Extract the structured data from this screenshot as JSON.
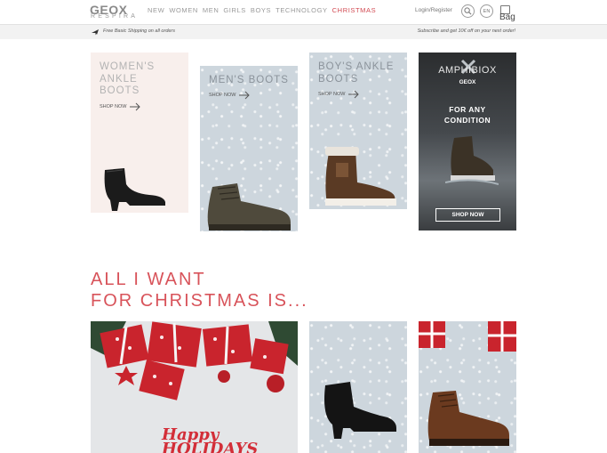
{
  "header": {
    "logo_main": "GEOX",
    "logo_sub": "RESPIRA",
    "nav": [
      "NEW",
      "WOMEN",
      "MEN",
      "GIRLS",
      "BOYS",
      "TECHNOLOGY",
      "CHRISTMAS"
    ],
    "login_label": "Login/Register",
    "lang_label": "EN",
    "bag_label": "Bag",
    "accent_color": "#d24a52"
  },
  "infobar": {
    "shipping_text": "Free Basic Shipping on all orders",
    "promo_text": "Subscribe and get 10€ off on your next order!"
  },
  "categories": [
    {
      "title_line1": "WOMEN'S",
      "title_line2": "ANKLE",
      "title_line3": "BOOTS",
      "cta": "SHOP NOW"
    },
    {
      "title_line1": "MEN'S BOOTS",
      "cta": "SHOP NOW"
    },
    {
      "title_line1": "BOY'S ANKLE",
      "title_line2": "BOOTS",
      "cta": "SHOP NOW"
    },
    {
      "brand": "AMPHIBIOX",
      "sub": "GEOX",
      "tagline_line1": "FOR ANY",
      "tagline_line2": "CONDITION",
      "cta": "SHOP NOW"
    }
  ],
  "christmas": {
    "heading_line1": "ALL I WANT",
    "heading_line2": "FOR CHRISTMAS IS...",
    "banner_text_line1": "Happy",
    "banner_text_line2": "HOLIDAYS"
  }
}
